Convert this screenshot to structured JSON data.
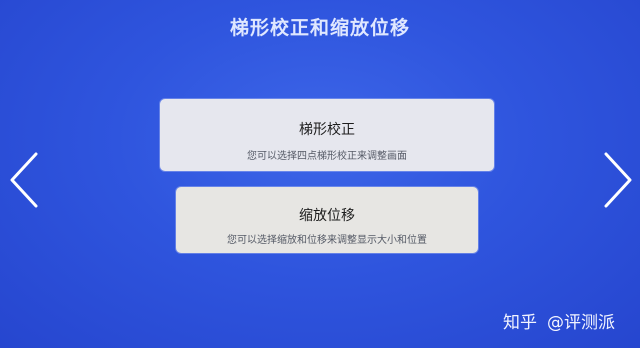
{
  "page": {
    "title": "梯形校正和缩放位移"
  },
  "options": [
    {
      "title": "梯形校正",
      "description": "您可以选择四点梯形校正来调整画面"
    },
    {
      "title": "缩放位移",
      "description": "您可以选择缩放和位移来调整显示大小和位置"
    }
  ],
  "navigation": {
    "left_icon": "chevron-left-icon",
    "right_icon": "chevron-right-icon"
  },
  "watermark": {
    "brand": "知乎",
    "handle": "@评测派"
  },
  "colors": {
    "background": "#2f55de",
    "card_bg": "#e6e7ee",
    "title_text": "#dfe7ff"
  }
}
